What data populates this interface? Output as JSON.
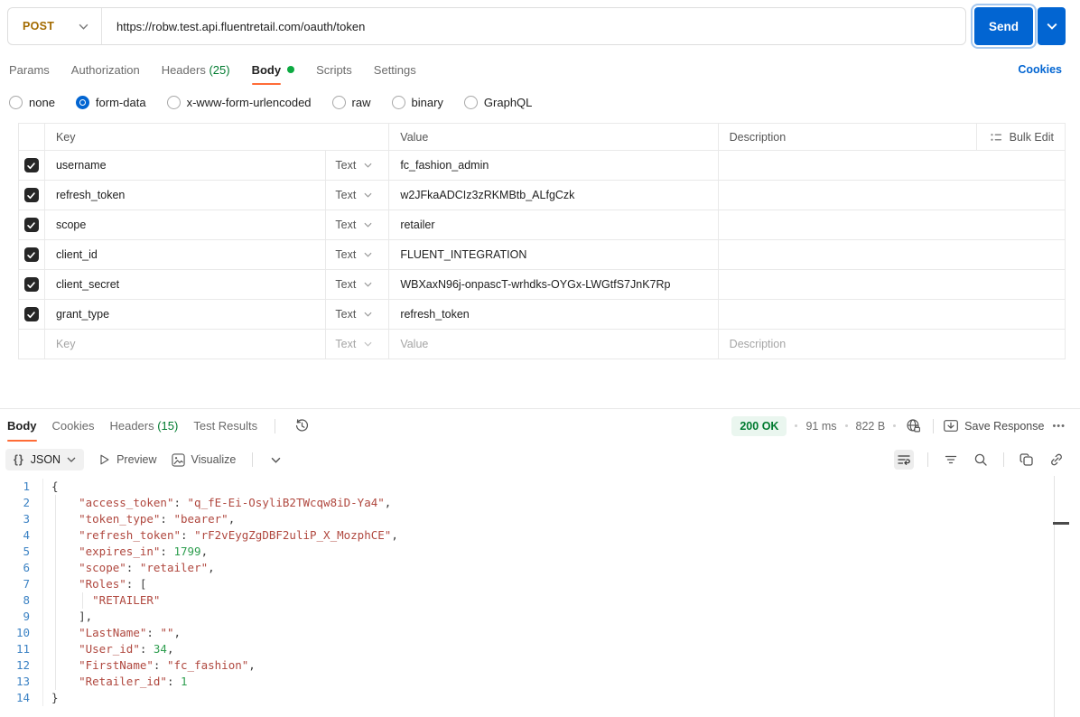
{
  "colors": {
    "accent_blue": "#0265d2",
    "postman_orange": "#ff6c37",
    "method_post": "#a36b00",
    "success_green": "#007a2f",
    "body_dot_green": "#0caa41",
    "status_badge_bg": "#eaf6ef",
    "json_key": "#b0483f",
    "json_string": "#b0483f",
    "json_number": "#2e9e4f",
    "line_number": "#3b82c4"
  },
  "icons": {
    "chevron_down": "v-shaped chevron",
    "history": "clock with counterclockwise arrow",
    "globe_lock": "globe with lock",
    "save_response": "card with down arrow",
    "more": "three dots",
    "bulk_edit": "list with dots",
    "preview": "play outline triangle",
    "visualize": "image frame",
    "wrap_text": "lines with return arrow",
    "filter": "descending lines",
    "search": "magnifier",
    "copy": "two overlapping squares",
    "link": "chain link",
    "check": "checkmark"
  },
  "request": {
    "method": "POST",
    "url": "https://robw.test.api.fluentretail.com/oauth/token",
    "send_label": "Send",
    "cookies_label": "Cookies",
    "tabs": [
      {
        "label": "Params"
      },
      {
        "label": "Authorization"
      },
      {
        "label": "Headers",
        "count": " (25)"
      },
      {
        "label": "Body",
        "active": true,
        "dot": true
      },
      {
        "label": "Scripts"
      },
      {
        "label": "Settings"
      }
    ],
    "body_modes": [
      {
        "label": "none"
      },
      {
        "label": "form-data",
        "selected": true
      },
      {
        "label": "x-www-form-urlencoded"
      },
      {
        "label": "raw"
      },
      {
        "label": "binary"
      },
      {
        "label": "GraphQL"
      }
    ]
  },
  "form_table": {
    "headers": {
      "key": "Key",
      "value": "Value",
      "description": "Description",
      "bulk_edit": "Bulk Edit"
    },
    "rows": [
      {
        "checked": true,
        "key": "username",
        "type": "Text",
        "value": "fc_fashion_admin",
        "description": ""
      },
      {
        "checked": true,
        "key": "refresh_token",
        "type": "Text",
        "value": "w2JFkaADCIz3zRKMBtb_ALfgCzk",
        "description": ""
      },
      {
        "checked": true,
        "key": "scope",
        "type": "Text",
        "value": "retailer",
        "description": ""
      },
      {
        "checked": true,
        "key": "client_id",
        "type": "Text",
        "value": "FLUENT_INTEGRATION",
        "description": ""
      },
      {
        "checked": true,
        "key": "client_secret",
        "type": "Text",
        "value": "WBXaxN96j-onpascT-wrhdks-OYGx-LWGtfS7JnK7Rp",
        "description": ""
      },
      {
        "checked": true,
        "key": "grant_type",
        "type": "Text",
        "value": "refresh_token",
        "description": ""
      }
    ],
    "empty_row": {
      "key": "Key",
      "type": "Text",
      "value": "Value",
      "description": "Description"
    }
  },
  "response": {
    "tabs": [
      {
        "label": "Body",
        "active": true
      },
      {
        "label": "Cookies"
      },
      {
        "label": "Headers",
        "count": " (15)"
      },
      {
        "label": "Test Results"
      }
    ],
    "status": "200 OK",
    "time": "91 ms",
    "size": "822 B",
    "save_label": "Save Response",
    "more_label": "•••",
    "format_braces": "{}",
    "format": "JSON",
    "preview_label": "Preview",
    "visualize_label": "Visualize",
    "code_lines": [
      [
        [
          "p",
          "{"
        ]
      ],
      [
        [
          "p",
          "    "
        ],
        [
          "k",
          "\"access_token\""
        ],
        [
          "p",
          ": "
        ],
        [
          "s",
          "\"q_fE-Ei-OsyliB2TWcqw8iD-Ya4\""
        ],
        [
          "p",
          ","
        ]
      ],
      [
        [
          "p",
          "    "
        ],
        [
          "k",
          "\"token_type\""
        ],
        [
          "p",
          ": "
        ],
        [
          "s",
          "\"bearer\""
        ],
        [
          "p",
          ","
        ]
      ],
      [
        [
          "p",
          "    "
        ],
        [
          "k",
          "\"refresh_token\""
        ],
        [
          "p",
          ": "
        ],
        [
          "s",
          "\"rF2vEygZgDBF2uliP_X_MozphCE\""
        ],
        [
          "p",
          ","
        ]
      ],
      [
        [
          "p",
          "    "
        ],
        [
          "k",
          "\"expires_in\""
        ],
        [
          "p",
          ": "
        ],
        [
          "n",
          "1799"
        ],
        [
          "p",
          ","
        ]
      ],
      [
        [
          "p",
          "    "
        ],
        [
          "k",
          "\"scope\""
        ],
        [
          "p",
          ": "
        ],
        [
          "s",
          "\"retailer\""
        ],
        [
          "p",
          ","
        ]
      ],
      [
        [
          "p",
          "    "
        ],
        [
          "k",
          "\"Roles\""
        ],
        [
          "p",
          ": ["
        ]
      ],
      [
        [
          "p",
          "      "
        ],
        [
          "s",
          "\"RETAILER\""
        ]
      ],
      [
        [
          "p",
          "    ],"
        ]
      ],
      [
        [
          "p",
          "    "
        ],
        [
          "k",
          "\"LastName\""
        ],
        [
          "p",
          ": "
        ],
        [
          "s",
          "\"\""
        ],
        [
          "p",
          ","
        ]
      ],
      [
        [
          "p",
          "    "
        ],
        [
          "k",
          "\"User_id\""
        ],
        [
          "p",
          ": "
        ],
        [
          "n",
          "34"
        ],
        [
          "p",
          ","
        ]
      ],
      [
        [
          "p",
          "    "
        ],
        [
          "k",
          "\"FirstName\""
        ],
        [
          "p",
          ": "
        ],
        [
          "s",
          "\"fc_fashion\""
        ],
        [
          "p",
          ","
        ]
      ],
      [
        [
          "p",
          "    "
        ],
        [
          "k",
          "\"Retailer_id\""
        ],
        [
          "p",
          ": "
        ],
        [
          "n",
          "1"
        ]
      ],
      [
        [
          "p",
          "}"
        ]
      ]
    ]
  }
}
